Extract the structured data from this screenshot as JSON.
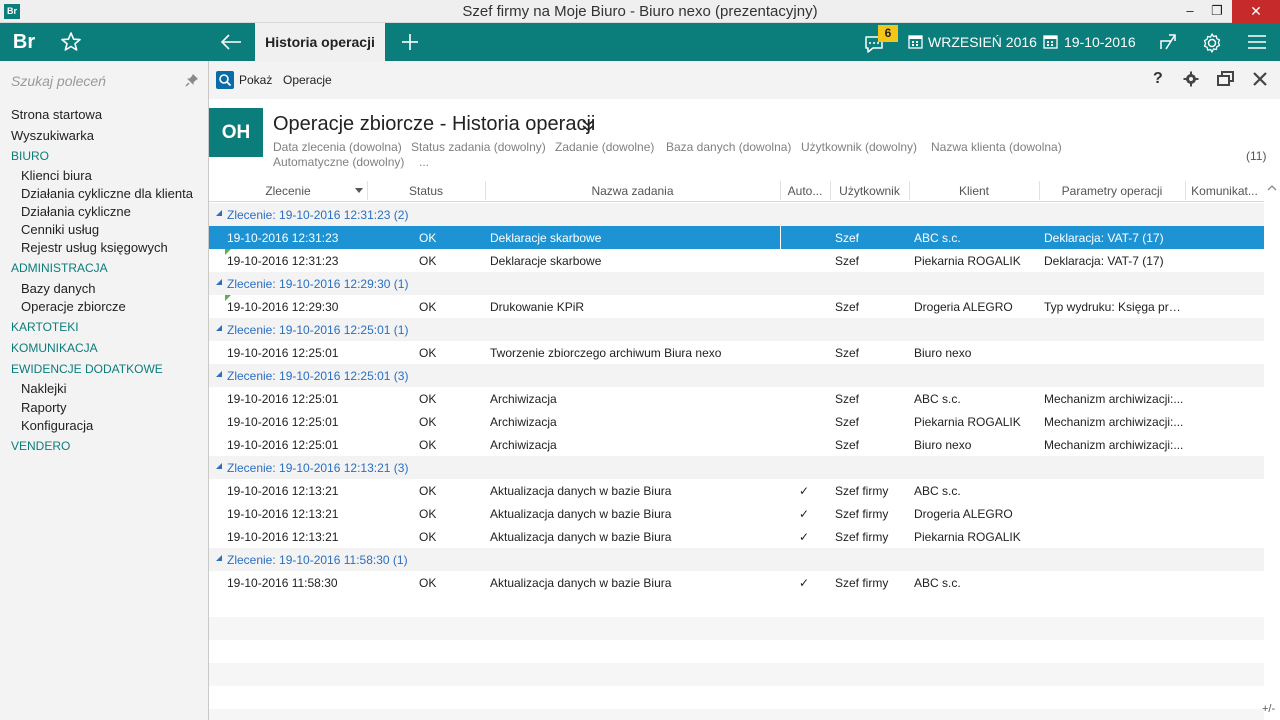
{
  "window": {
    "title": "Szef firmy na Moje Biuro - Biuro nexo (prezentacyjny)",
    "app_icon": "Br",
    "min_glyph": "‒",
    "max_glyph": "❐",
    "close_glyph": "✕"
  },
  "topbar": {
    "brand": "Br",
    "active_tab": "Historia operacji",
    "notification_count": "6",
    "period": "WRZESIEŃ 2016",
    "date": "19-10-2016",
    "accent": "#0b7d7b",
    "badge_color": "#f5c518"
  },
  "sidebar": {
    "search_placeholder": "Szukaj poleceń",
    "items": [
      {
        "label": "Strona startowa",
        "level": "lvl0"
      },
      {
        "label": "Wyszukiwarka",
        "level": "lvl0"
      },
      {
        "label": "BIURO",
        "level": "section"
      },
      {
        "label": "Klienci biura",
        "level": "lvl1"
      },
      {
        "label": "Działania cykliczne dla klienta",
        "level": "lvl1"
      },
      {
        "label": "Działania cykliczne",
        "level": "lvl1"
      },
      {
        "label": "Cenniki usług",
        "level": "lvl1"
      },
      {
        "label": "Rejestr usług księgowych",
        "level": "lvl1"
      },
      {
        "label": "ADMINISTRACJA",
        "level": "section"
      },
      {
        "label": "Bazy danych",
        "level": "lvl1"
      },
      {
        "label": "Operacje zbiorcze",
        "level": "lvl1"
      },
      {
        "label": "KARTOTEKI",
        "level": "section"
      },
      {
        "label": "KOMUNIKACJA",
        "level": "section"
      },
      {
        "label": "EWIDENCJE DODATKOWE",
        "level": "section"
      },
      {
        "label": "Naklejki",
        "level": "lvl1"
      },
      {
        "label": "Raporty",
        "level": "lvl1"
      },
      {
        "label": "Konfiguracja",
        "level": "lvl1"
      },
      {
        "label": "VENDERO",
        "level": "section"
      }
    ]
  },
  "toolbar": {
    "show_label": "Pokaż",
    "operations_label": "Operacje",
    "help_label": "?"
  },
  "header": {
    "tile": "OH",
    "title": "Operacje zbiorcze - Historia operacji",
    "filters": [
      "Data zlecenia (dowolna)",
      "Status zadania (dowolny)",
      "Zadanie (dowolne)",
      "Baza danych (dowolna)",
      "Użytkownik (dowolny)",
      "Nazwa klienta (dowolna)",
      "Automatyczne (dowolny)",
      "..."
    ],
    "count": "(11)"
  },
  "grid": {
    "columns": [
      "Zlecenie",
      "Status",
      "Nazwa zadania",
      "Auto...",
      "Użytkownik",
      "Klient",
      "Parametry operacji",
      "Komunikat..."
    ],
    "rows": [
      {
        "type": "group",
        "text": "Zlecenie: 19-10-2016 12:31:23 (2)"
      },
      {
        "type": "data",
        "selected": true,
        "flag": false,
        "date": "19-10-2016 12:31:23",
        "status": "OK",
        "task": "Deklaracje skarbowe",
        "auto": "",
        "user": "Szef",
        "client": "ABC s.c.",
        "params": "Deklaracja: VAT-7 (17)",
        "comm": ""
      },
      {
        "type": "data",
        "selected": false,
        "flag": true,
        "date": "19-10-2016 12:31:23",
        "status": "OK",
        "task": "Deklaracje skarbowe",
        "auto": "",
        "user": "Szef",
        "client": "Piekarnia ROGALIK",
        "params": "Deklaracja: VAT-7 (17)",
        "comm": ""
      },
      {
        "type": "group",
        "text": "Zlecenie: 19-10-2016 12:29:30 (1)"
      },
      {
        "type": "data",
        "selected": false,
        "flag": true,
        "date": "19-10-2016 12:29:30",
        "status": "OK",
        "task": "Drukowanie KPiR",
        "auto": "",
        "user": "Szef",
        "client": "Drogeria ALEGRO",
        "params": "Typ wydruku: Księga prz...",
        "comm": ""
      },
      {
        "type": "group",
        "text": "Zlecenie: 19-10-2016 12:25:01 (1)"
      },
      {
        "type": "data",
        "selected": false,
        "flag": false,
        "date": "19-10-2016 12:25:01",
        "status": "OK",
        "task": "Tworzenie zbiorczego archiwum Biura nexo",
        "auto": "",
        "user": "Szef",
        "client": "Biuro nexo",
        "params": "",
        "comm": ""
      },
      {
        "type": "group",
        "text": "Zlecenie: 19-10-2016 12:25:01 (3)"
      },
      {
        "type": "data",
        "selected": false,
        "flag": false,
        "date": "19-10-2016 12:25:01",
        "status": "OK",
        "task": "Archiwizacja",
        "auto": "",
        "user": "Szef",
        "client": "ABC s.c.",
        "params": "Mechanizm archiwizacji:...",
        "comm": ""
      },
      {
        "type": "data",
        "selected": false,
        "flag": false,
        "date": "19-10-2016 12:25:01",
        "status": "OK",
        "task": "Archiwizacja",
        "auto": "",
        "user": "Szef",
        "client": "Piekarnia ROGALIK",
        "params": "Mechanizm archiwizacji:...",
        "comm": ""
      },
      {
        "type": "data",
        "selected": false,
        "flag": false,
        "date": "19-10-2016 12:25:01",
        "status": "OK",
        "task": "Archiwizacja",
        "auto": "",
        "user": "Szef",
        "client": "Biuro nexo",
        "params": "Mechanizm archiwizacji:...",
        "comm": ""
      },
      {
        "type": "group",
        "text": "Zlecenie: 19-10-2016 12:13:21 (3)"
      },
      {
        "type": "data",
        "selected": false,
        "flag": false,
        "date": "19-10-2016 12:13:21",
        "status": "OK",
        "task": "Aktualizacja danych w bazie Biura",
        "auto": "✓",
        "user": "Szef firmy",
        "client": "ABC s.c.",
        "params": "",
        "comm": ""
      },
      {
        "type": "data",
        "selected": false,
        "flag": false,
        "date": "19-10-2016 12:13:21",
        "status": "OK",
        "task": "Aktualizacja danych w bazie Biura",
        "auto": "✓",
        "user": "Szef firmy",
        "client": "Drogeria ALEGRO",
        "params": "",
        "comm": ""
      },
      {
        "type": "data",
        "selected": false,
        "flag": false,
        "date": "19-10-2016 12:13:21",
        "status": "OK",
        "task": "Aktualizacja danych w bazie Biura",
        "auto": "✓",
        "user": "Szef firmy",
        "client": "Piekarnia ROGALIK",
        "params": "",
        "comm": ""
      },
      {
        "type": "group",
        "text": "Zlecenie: 19-10-2016 11:58:30 (1)"
      },
      {
        "type": "data",
        "selected": false,
        "flag": false,
        "date": "19-10-2016 11:58:30",
        "status": "OK",
        "task": "Aktualizacja danych w bazie Biura",
        "auto": "✓",
        "user": "Szef firmy",
        "client": "ABC s.c.",
        "params": "",
        "comm": ""
      }
    ],
    "selected_color": "#1e93d3",
    "group_color": "#2a6fc2"
  },
  "footer": {
    "resize_label": "+/-"
  }
}
